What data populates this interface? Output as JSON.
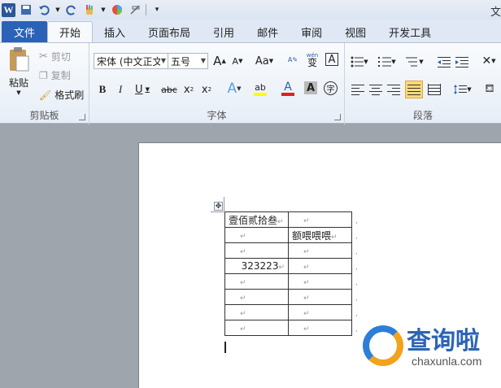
{
  "qat": {
    "app_icon": "W",
    "title_fragment": "文"
  },
  "tabs": [
    {
      "label": "文件"
    },
    {
      "label": "开始"
    },
    {
      "label": "插入"
    },
    {
      "label": "页面布局"
    },
    {
      "label": "引用"
    },
    {
      "label": "邮件"
    },
    {
      "label": "审阅"
    },
    {
      "label": "视图"
    },
    {
      "label": "开发工具"
    }
  ],
  "clipboard": {
    "paste": "粘贴",
    "cut": "剪切",
    "copy": "复制",
    "format_painter": "格式刷",
    "label": "剪贴板"
  },
  "font": {
    "family": "宋体 (中文正文",
    "size": "五号",
    "grow": "A",
    "shrink": "A",
    "change_case": "Aa",
    "phonetic": "wén",
    "phonetic_char": "变",
    "char_border": "A",
    "bold": "B",
    "italic": "I",
    "underline": "U",
    "strike": "abc",
    "subscript": "x",
    "superscript": "x",
    "sub_mark": "2",
    "sup_mark": "2",
    "text_effect": "A",
    "highlight": "ab",
    "font_color": "A",
    "char_shading": "A",
    "enclose": "字",
    "label": "字体"
  },
  "paragraph": {
    "label": "段落"
  },
  "table": {
    "rows": [
      [
        "壹佰贰拾叁",
        ""
      ],
      [
        "",
        "额喂喂喂"
      ],
      [
        "",
        ""
      ],
      [
        "323223",
        ""
      ],
      [
        "",
        ""
      ],
      [
        "",
        ""
      ],
      [
        "",
        ""
      ],
      [
        "",
        ""
      ]
    ],
    "cell_mark": "↵",
    "row_end_mark": ","
  },
  "watermark": {
    "brand": "查询啦",
    "domain": "chaxunla.com"
  },
  "colors": {
    "file_tab": "#2a62b8",
    "highlight": "#ffff00",
    "font_color": "#e02020"
  }
}
